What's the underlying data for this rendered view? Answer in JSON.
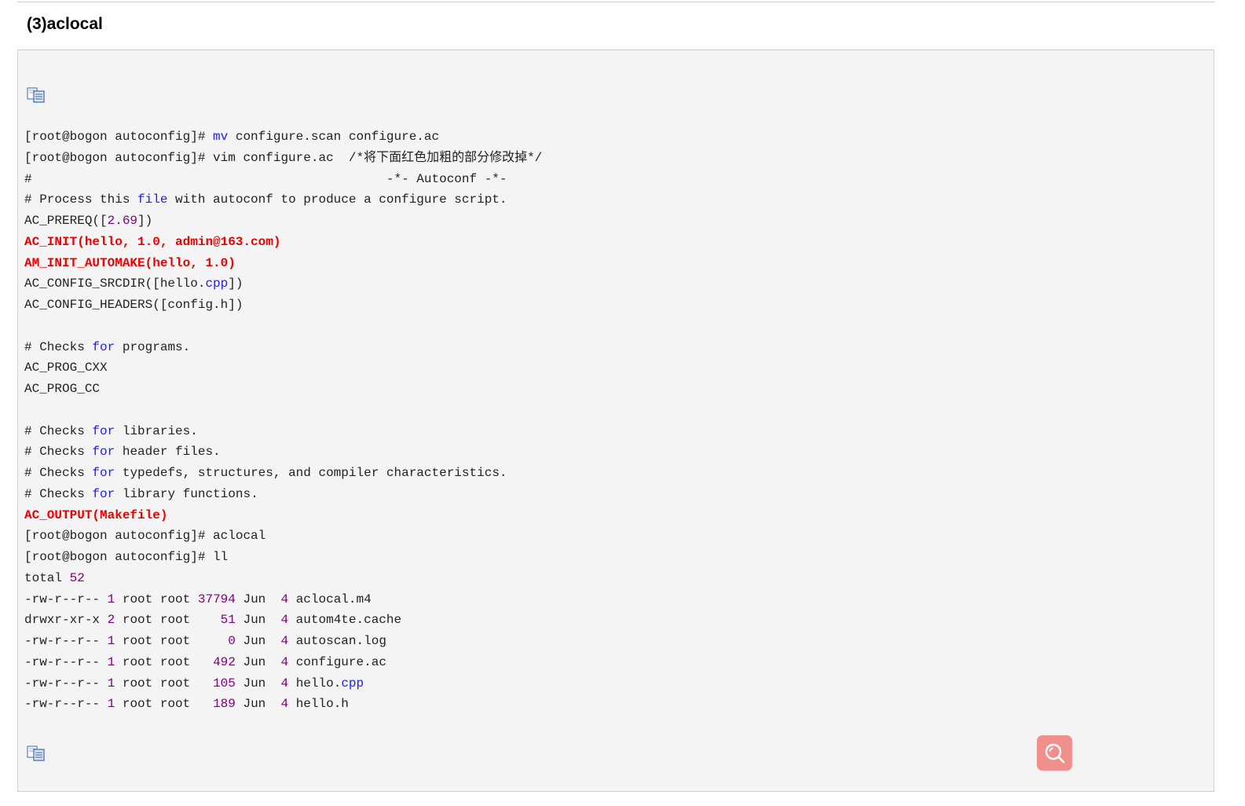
{
  "section": {
    "heading": "(3)aclocal"
  },
  "toolbar": {
    "copy_icon": "copy-code-icon",
    "search_icon": "search-icon",
    "search_button_color": "#f0908c"
  },
  "code_lines": [
    [
      {
        "t": "[root@bogon autoconfig]# "
      },
      {
        "t": "mv",
        "c": "kw"
      },
      {
        "t": " configure.scan configure.ac"
      }
    ],
    [
      {
        "t": "[root@bogon autoconfig]# vim configure.ac  /*将下面红色加粗的部分修改掉*/"
      }
    ],
    [
      {
        "t": "#                                               -*- Autoconf -*-"
      }
    ],
    [
      {
        "t": "# Process this "
      },
      {
        "t": "file",
        "c": "kw"
      },
      {
        "t": " with autoconf to produce a configure script."
      }
    ],
    [
      {
        "t": "AC_PREREQ(["
      },
      {
        "t": "2.69",
        "c": "num"
      },
      {
        "t": "])"
      }
    ],
    [
      {
        "t": "AC_INIT(hello, 1.0, admin@163.com)",
        "c": "red"
      }
    ],
    [
      {
        "t": "AM_INIT_AUTOMAKE(hello, 1.0)",
        "c": "red"
      }
    ],
    [
      {
        "t": "AC_CONFIG_SRCDIR([hello."
      },
      {
        "t": "cpp",
        "c": "kw"
      },
      {
        "t": "])"
      }
    ],
    [
      {
        "t": "AC_CONFIG_HEADERS([config.h])"
      }
    ],
    [
      {
        "t": ""
      }
    ],
    [
      {
        "t": "# Checks "
      },
      {
        "t": "for",
        "c": "kw"
      },
      {
        "t": " programs."
      }
    ],
    [
      {
        "t": "AC_PROG_CXX"
      }
    ],
    [
      {
        "t": "AC_PROG_CC"
      }
    ],
    [
      {
        "t": ""
      }
    ],
    [
      {
        "t": "# Checks "
      },
      {
        "t": "for",
        "c": "kw"
      },
      {
        "t": " libraries."
      }
    ],
    [
      {
        "t": "# Checks "
      },
      {
        "t": "for",
        "c": "kw"
      },
      {
        "t": " header files."
      }
    ],
    [
      {
        "t": "# Checks "
      },
      {
        "t": "for",
        "c": "kw"
      },
      {
        "t": " typedefs, structures, and compiler characteristics."
      }
    ],
    [
      {
        "t": "# Checks "
      },
      {
        "t": "for",
        "c": "kw"
      },
      {
        "t": " library functions."
      }
    ],
    [
      {
        "t": "AC_OUTPUT(Makefile)",
        "c": "red"
      }
    ],
    [
      {
        "t": "[root@bogon autoconfig]# aclocal"
      }
    ],
    [
      {
        "t": "[root@bogon autoconfig]# ll"
      }
    ],
    [
      {
        "t": "total "
      },
      {
        "t": "52",
        "c": "num"
      }
    ],
    [
      {
        "t": "-rw-r--r-- "
      },
      {
        "t": "1",
        "c": "num"
      },
      {
        "t": " root root "
      },
      {
        "t": "37794",
        "c": "num"
      },
      {
        "t": " Jun  "
      },
      {
        "t": "4",
        "c": "num"
      },
      {
        "t": " aclocal.m4"
      }
    ],
    [
      {
        "t": "drwxr-xr-x "
      },
      {
        "t": "2",
        "c": "num"
      },
      {
        "t": " root root    "
      },
      {
        "t": "51",
        "c": "num"
      },
      {
        "t": " Jun  "
      },
      {
        "t": "4",
        "c": "num"
      },
      {
        "t": " autom4te.cache"
      }
    ],
    [
      {
        "t": "-rw-r--r-- "
      },
      {
        "t": "1",
        "c": "num"
      },
      {
        "t": " root root     "
      },
      {
        "t": "0",
        "c": "num"
      },
      {
        "t": " Jun  "
      },
      {
        "t": "4",
        "c": "num"
      },
      {
        "t": " autoscan.log"
      }
    ],
    [
      {
        "t": "-rw-r--r-- "
      },
      {
        "t": "1",
        "c": "num"
      },
      {
        "t": " root root   "
      },
      {
        "t": "492",
        "c": "num"
      },
      {
        "t": " Jun  "
      },
      {
        "t": "4",
        "c": "num"
      },
      {
        "t": " configure.ac"
      }
    ],
    [
      {
        "t": "-rw-r--r-- "
      },
      {
        "t": "1",
        "c": "num"
      },
      {
        "t": " root root   "
      },
      {
        "t": "105",
        "c": "num"
      },
      {
        "t": " Jun  "
      },
      {
        "t": "4",
        "c": "num"
      },
      {
        "t": " hello."
      },
      {
        "t": "cpp",
        "c": "kw"
      }
    ],
    [
      {
        "t": "-rw-r--r-- "
      },
      {
        "t": "1",
        "c": "num"
      },
      {
        "t": " root root   "
      },
      {
        "t": "189",
        "c": "num"
      },
      {
        "t": " Jun  "
      },
      {
        "t": "4",
        "c": "num"
      },
      {
        "t": " hello.h"
      }
    ]
  ]
}
